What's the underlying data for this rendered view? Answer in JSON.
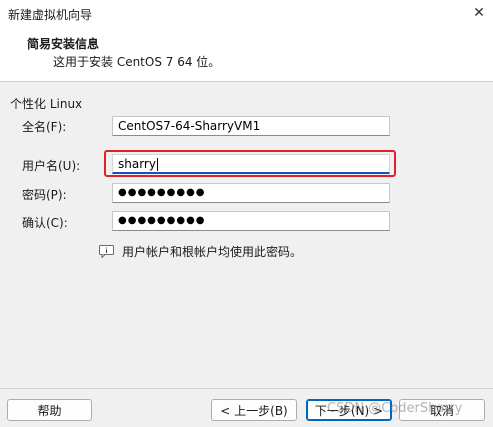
{
  "window": {
    "title": "新建虚拟机向导",
    "close_icon": "close-icon"
  },
  "header": {
    "heading": "简易安装信息",
    "subtitle": "这用于安装 CentOS 7 64 位。"
  },
  "group": {
    "title": "个性化 Linux"
  },
  "form": {
    "fullname": {
      "label": "全名(F):",
      "value": "CentOS7-64-SharryVM1"
    },
    "username": {
      "label": "用户名(U):",
      "value": "sharry"
    },
    "password": {
      "label": "密码(P):",
      "value": "●●●●●●●●●"
    },
    "confirm": {
      "label": "确认(C):",
      "value": "●●●●●●●●●"
    }
  },
  "note": {
    "icon": "info-icon",
    "text": "用户帐户和根帐户均使用此密码。"
  },
  "buttons": {
    "help": "帮助",
    "back": "< 上一步(B)",
    "next": "下一步(N) >",
    "cancel": "取消"
  },
  "watermark": "CSDN @CoderSharry",
  "colors": {
    "highlight": "#e0202a",
    "focus_underline": "#1a4fbf",
    "primary_border": "#0067c0"
  }
}
